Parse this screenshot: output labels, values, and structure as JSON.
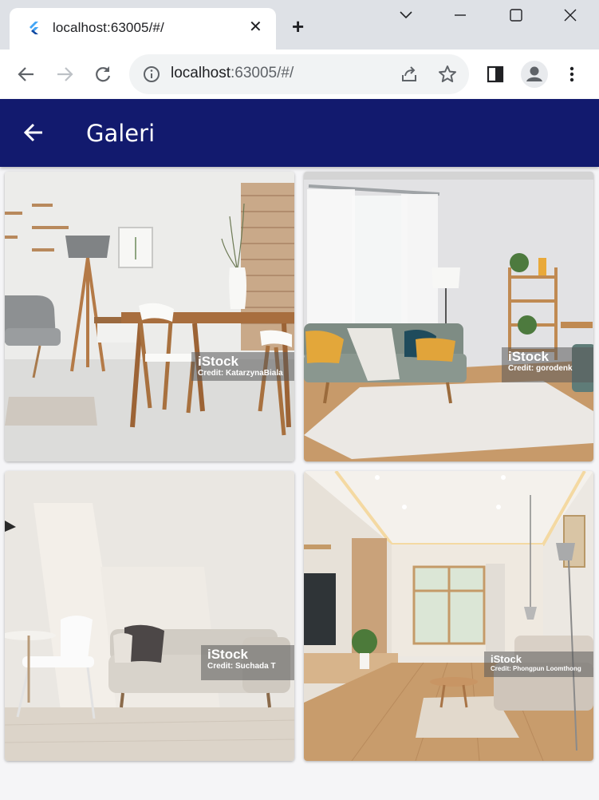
{
  "browser": {
    "tab_title": "localhost:63005/#/",
    "url_host": "localhost",
    "url_rest": ":63005/#/"
  },
  "app": {
    "title": "Galeri",
    "appbar_color": "#121a6e"
  },
  "gallery": {
    "items": [
      {
        "watermark": "iStock",
        "credit": "Credit: KatarzynaBiala"
      },
      {
        "watermark": "iStock",
        "credit": "Credit: gorodenk"
      },
      {
        "watermark": "iStock",
        "credit": "Credit: Suchada T"
      },
      {
        "watermark": "iStock",
        "credit": "Credit: Phongpun Loomthong"
      }
    ]
  },
  "icons": [
    "flutter-icon",
    "close-icon",
    "plus-icon",
    "chevron-down-icon",
    "minimize-icon",
    "maximize-icon",
    "window-close-icon",
    "back-icon",
    "forward-icon",
    "reload-icon",
    "info-icon",
    "share-icon",
    "star-icon",
    "side-panel-icon",
    "profile-icon",
    "more-icon",
    "arrow-back-icon"
  ]
}
